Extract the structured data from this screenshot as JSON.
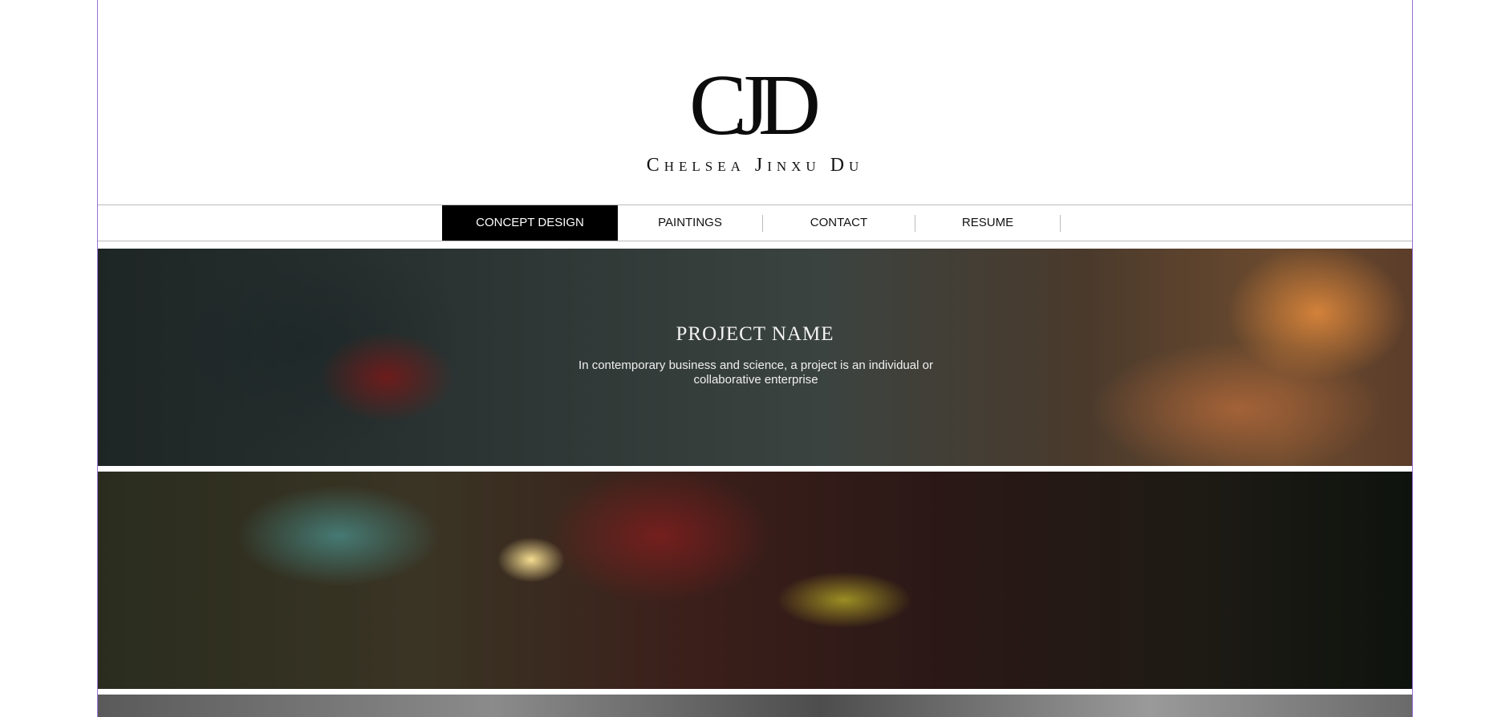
{
  "brand": {
    "monogram": "CJD",
    "name": "Chelsea Jinxu Du"
  },
  "nav": {
    "items": [
      {
        "label": "CONCEPT DESIGN",
        "active": true
      },
      {
        "label": "PAINTINGS",
        "active": false
      },
      {
        "label": "CONTACT",
        "active": false
      },
      {
        "label": "RESUME",
        "active": false
      }
    ]
  },
  "banners": [
    {
      "title": "PROJECT NAME",
      "description": "In contemporary business and science, a project is an individual or collaborative enterprise"
    }
  ],
  "colors": {
    "accent": "#000000",
    "page_border": "#9b6fd6"
  }
}
